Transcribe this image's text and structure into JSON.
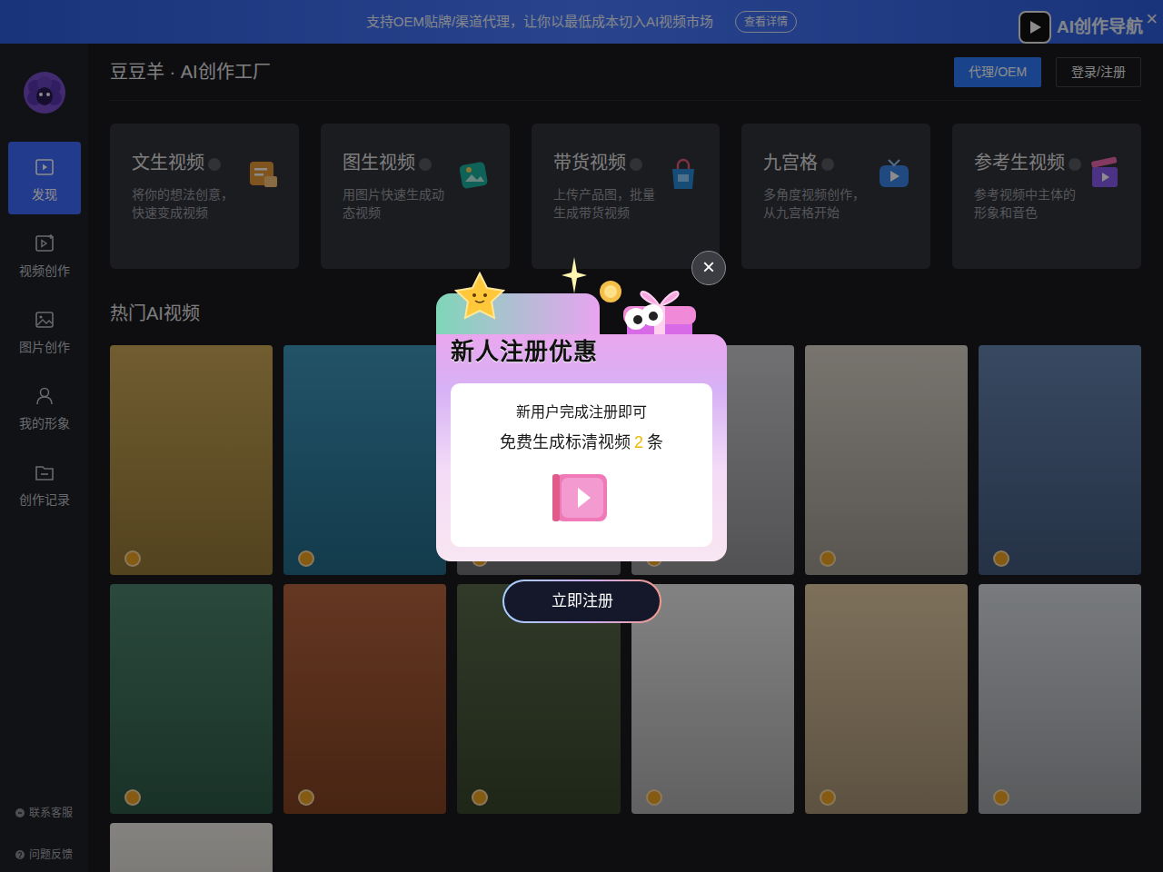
{
  "banner": {
    "text": "支持OEM贴牌/渠道代理，让你以最低成本切入AI视频市场",
    "button": "查看详情",
    "logo": "AI创作导航",
    "close": "×"
  },
  "sidebar": {
    "items": [
      {
        "label": "发现",
        "selected": true
      },
      {
        "label": "视频创作",
        "selected": false
      },
      {
        "label": "图片创作",
        "selected": false
      },
      {
        "label": "我的形象",
        "selected": false
      },
      {
        "label": "创作记录",
        "selected": false
      }
    ],
    "footer": [
      "联系客服",
      "问题反馈"
    ]
  },
  "header": {
    "title": "豆豆羊 · AI创作工厂",
    "buttons": [
      "代理/OEM",
      "登录/注册"
    ]
  },
  "features": [
    {
      "title": "文生视频",
      "desc": "将你的想法创意，快速变成视频"
    },
    {
      "title": "图生视频",
      "desc": "用图片快速生成动态视频"
    },
    {
      "title": "带货视频",
      "desc": "上传产品图，批量生成带货视频"
    },
    {
      "title": "九宫格",
      "desc": "多角度视频创作，从九宫格开始"
    },
    {
      "title": "参考生视频",
      "desc": "参考视频中主体的形象和音色"
    }
  ],
  "section": {
    "title": "热门AI视频"
  },
  "videos": [
    {
      "color": "#c9a24a"
    },
    {
      "color": "#2f8fb8"
    },
    {
      "color": "#9a9aa0"
    },
    {
      "color": "#c8c8cc"
    },
    {
      "color": "#d8d0c4"
    },
    {
      "color": "#5a7aaa"
    },
    {
      "color": "#3f7a62"
    },
    {
      "color": "#b0582e"
    },
    {
      "color": "#4c5e3c"
    },
    {
      "color": "#ececec"
    },
    {
      "color": "#e2c89e"
    },
    {
      "color": "#d8dce2"
    },
    {
      "color": "#f0ece4"
    }
  ],
  "modal": {
    "close": "×",
    "title": "新人注册优惠",
    "line1": "新用户完成注册即可",
    "line2_before": "免费生成标清视频",
    "count": "2",
    "line2_after": "条",
    "button": "立即注册"
  }
}
